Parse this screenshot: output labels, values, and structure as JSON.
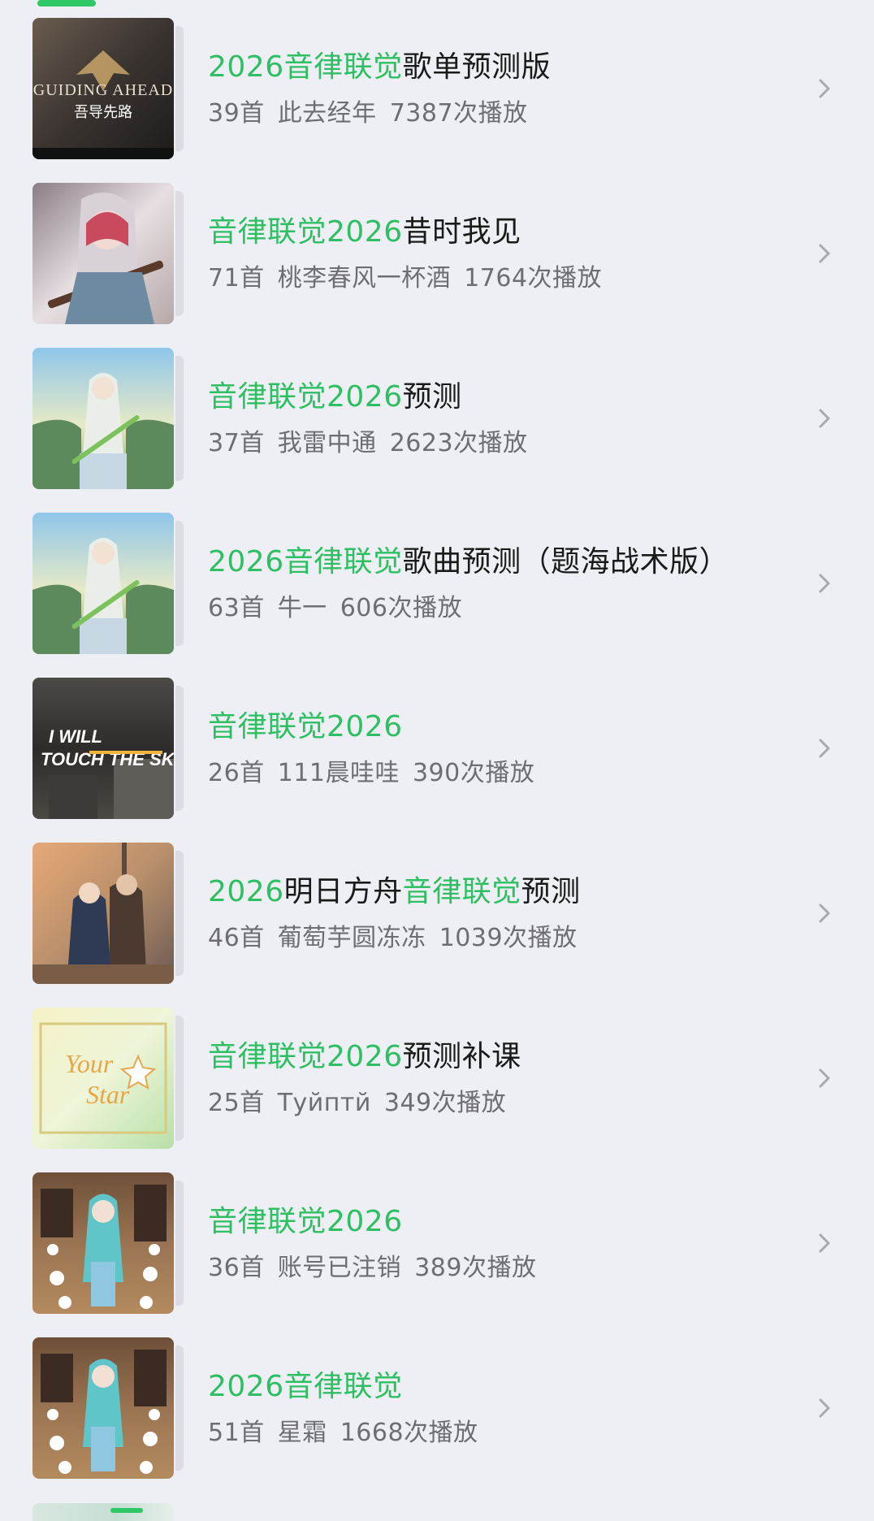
{
  "colors": {
    "background": "#eeeff4",
    "highlight": "#2fbf63",
    "title": "#1a1a1a",
    "meta": "#6d6d72"
  },
  "playlists": [
    {
      "title_parts": [
        {
          "text": "2026音律联觉",
          "hl": true
        },
        {
          "text": "歌单预测版",
          "hl": false
        }
      ],
      "count": "39首",
      "creator": "此去经年",
      "plays": "7387次播放",
      "cover": "guiding-ahead",
      "cover_text_1": "GUIDING AHEAD",
      "cover_text_2": "吾导先路"
    },
    {
      "title_parts": [
        {
          "text": "音律联觉2026",
          "hl": true
        },
        {
          "text": "昔时我见",
          "hl": false
        }
      ],
      "count": "71首",
      "creator": "桃李春风一杯酒",
      "plays": "1764次播放",
      "cover": "girl-rifle"
    },
    {
      "title_parts": [
        {
          "text": "音律联觉2026",
          "hl": true
        },
        {
          "text": "预测",
          "hl": false
        }
      ],
      "count": "37首",
      "creator": "我雷中通",
      "plays": "2623次播放",
      "cover": "field-girl"
    },
    {
      "title_parts": [
        {
          "text": "2026音律联觉",
          "hl": true
        },
        {
          "text": "歌曲预测（题海战术版）",
          "hl": false
        }
      ],
      "count": "63首",
      "creator": "牛一",
      "plays": "606次播放",
      "cover": "field-girl"
    },
    {
      "title_parts": [
        {
          "text": "音律联觉2026",
          "hl": true
        }
      ],
      "count": "26首",
      "creator": "111晨哇哇",
      "plays": "390次播放",
      "cover": "touch-sky",
      "cover_text_1": "I WILL",
      "cover_text_2": "TOUCH THE SKY"
    },
    {
      "title_parts": [
        {
          "text": "2026",
          "hl": true
        },
        {
          "text": "明日方舟",
          "hl": false
        },
        {
          "text": "音律联觉",
          "hl": true
        },
        {
          "text": "预测",
          "hl": false
        }
      ],
      "count": "46首",
      "creator": "葡萄芋圆冻冻",
      "plays": "1039次播放",
      "cover": "ship-pair"
    },
    {
      "title_parts": [
        {
          "text": "音律联觉2026",
          "hl": true
        },
        {
          "text": "预测补课",
          "hl": false
        }
      ],
      "count": "25首",
      "creator": "Туйптй",
      "plays": "349次播放",
      "cover": "your-star",
      "cover_text_1": "Your",
      "cover_text_2": "Star"
    },
    {
      "title_parts": [
        {
          "text": "音律联觉2026",
          "hl": true
        }
      ],
      "count": "36首",
      "creator": "账号已注销",
      "plays": "389次播放",
      "cover": "studio-girl"
    },
    {
      "title_parts": [
        {
          "text": "2026音律联觉",
          "hl": true
        }
      ],
      "count": "51首",
      "creator": "星霜",
      "plays": "1668次播放",
      "cover": "studio-girl"
    }
  ]
}
